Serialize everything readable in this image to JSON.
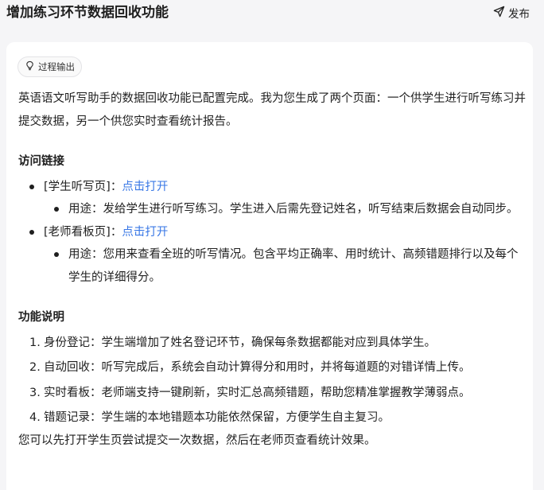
{
  "header": {
    "title": "增加练习环节数据回收功能",
    "publish_label": "发布"
  },
  "chip": {
    "label": "过程输出"
  },
  "intro": "英语语文听写助手的数据回收功能已配置完成。我为您生成了两个页面：一个供学生进行听写练习并提交数据，另一个供您实时查看统计报告。",
  "links_section": {
    "title": "访问链接",
    "items": [
      {
        "name": "[学生听写页]：",
        "link": "点击打开",
        "usage": "用途：发给学生进行听写练习。学生进入后需先登记姓名，听写结束后数据会自动同步。"
      },
      {
        "name": "[老师看板页]：",
        "link": "点击打开",
        "usage": "用途：您用来查看全班的听写情况。包含平均正确率、用时统计、高频错题排行以及每个学生的详细得分。"
      }
    ]
  },
  "features": {
    "title": "功能说明",
    "items": [
      {
        "num": "1.",
        "text": "身份登记：学生端增加了姓名登记环节，确保每条数据都能对应到具体学生。"
      },
      {
        "num": "2.",
        "text": "自动回收：听写完成后，系统会自动计算得分和用时，并将每道题的对错详情上传。"
      },
      {
        "num": "3.",
        "text": "实时看板：老师端支持一键刷新，实时汇总高频错题，帮助您精准掌握教学薄弱点。"
      },
      {
        "num": "4.",
        "text": "错题记录：学生端的本地错题本功能依然保留，方便学生自主复习。"
      }
    ]
  },
  "closing": "您可以先打开学生页尝试提交一次数据，然后在老师页查看统计效果。"
}
